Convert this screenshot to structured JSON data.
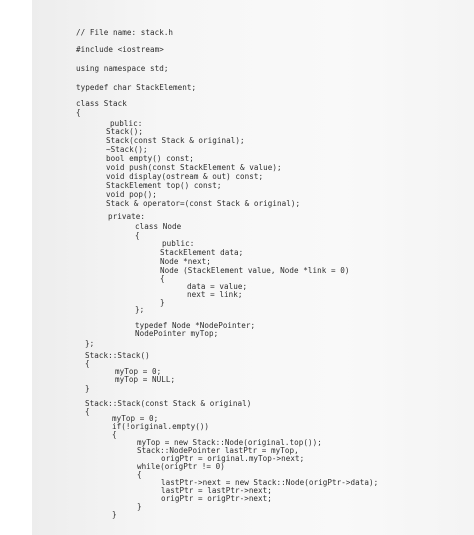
{
  "document": {
    "lines": [
      "// File name: stack.h",
      "#include <iostream>",
      "using namespace std;",
      "typedef char StackElement;",
      "class Stack",
      "{",
      "public:",
      "Stack();",
      "Stack(const Stack & original);",
      "~Stack();",
      "bool empty() const;",
      "void push(const StackElement & value);",
      "void display(ostream & out) const;",
      "StackElement top() const;",
      "void pop();",
      "Stack & operator=(const Stack & original);",
      "private:",
      "class Node",
      "{",
      "public:",
      "StackElement data;",
      "Node *next;",
      "Node (StackElement value, Node *link = 0)",
      "{",
      "data = value;",
      "next = link;",
      "}",
      "};",
      "typedef Node *NodePointer;",
      "NodePointer myTop;",
      "};",
      "Stack::Stack()",
      "{",
      "myTop = 0;",
      "myTop = NULL;",
      "}",
      "Stack::Stack(const Stack & original)",
      "{",
      "myTop = 0;",
      "if(!original.empty())",
      "{",
      "myTop = new Stack::Node(original.top());",
      "Stack::NodePointer lastPtr = myTop,",
      "origPtr = original.myTop->next;",
      "while(origPtr != 0)",
      "{",
      "lastPtr->next = new Stack::Node(origPtr->data);",
      "lastPtr = lastPtr->next;",
      "origPtr = origPtr->next;",
      "}",
      "}"
    ]
  }
}
